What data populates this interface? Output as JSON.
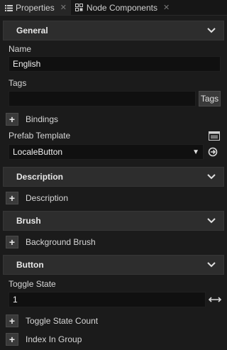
{
  "tabs": [
    {
      "label": "Properties",
      "icon": "list-icon"
    },
    {
      "label": "Node Components",
      "icon": "components-icon"
    }
  ],
  "sections": {
    "general": "General",
    "description": "Description",
    "brush": "Brush",
    "button": "Button"
  },
  "general": {
    "name_label": "Name",
    "name_value": "English",
    "tags_label": "Tags",
    "tags_value": "",
    "tags_button": "Tags",
    "bindings_label": "Bindings",
    "prefab_label": "Prefab Template",
    "prefab_value": "LocaleButton"
  },
  "description": {
    "description_label": "Description"
  },
  "brush": {
    "background_label": "Background Brush"
  },
  "button": {
    "toggle_state_label": "Toggle State",
    "toggle_state_value": "1",
    "toggle_state_count_label": "Toggle State Count",
    "index_in_group_label": "Index In Group"
  },
  "colors": {
    "background": "#1b1b1b",
    "section_header": "#2d2d2d",
    "field": "#101010",
    "text": "#d6d6d6"
  }
}
